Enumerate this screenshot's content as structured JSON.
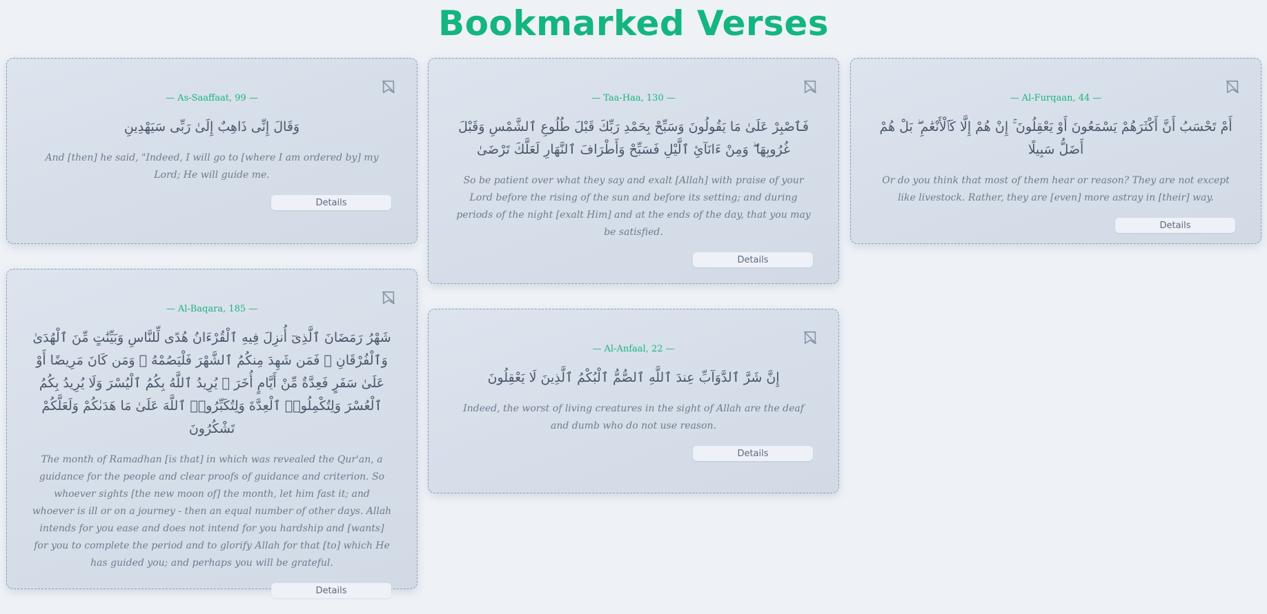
{
  "page": {
    "title": "Bookmarked Verses"
  },
  "colors": {
    "accent": "#14b57e",
    "card_bg": "#d8e0ea",
    "page_bg": "#eef2f7"
  },
  "cards": [
    {
      "ref": "— As-Saaffaat, 99 —",
      "arabic": "وَقَالَ إِنِّى ذَاهِبٌ إِلَىٰ رَبِّى سَيَهْدِينِ",
      "translation": "And [then] he said, \"Indeed, I will go to [where I am ordered by] my Lord; He will guide me.",
      "details_label": "Details",
      "bookmark_icon": "bookmark-off-icon"
    },
    {
      "ref": "— Al-Baqara, 185 —",
      "arabic": "شَهْرُ رَمَضَانَ ٱلَّذِىٓ أُنزِلَ فِيهِ ٱلْقُرْءَانُ هُدًى لِّلنَّاسِ وَبَيِّنَٰتٍ مِّنَ ٱلْهُدَىٰ وَٱلْفُرْقَانِ ۚ فَمَن شَهِدَ مِنكُمُ ٱلشَّهْرَ فَلْيَصُمْهُ ۖ وَمَن كَانَ مَرِيضًا أَوْ عَلَىٰ سَفَرٍ فَعِدَّةٌ مِّنْ أَيَّامٍ أُخَرَ ۗ يُرِيدُ ٱللَّهُ بِكُمُ ٱلْيُسْرَ وَلَا يُرِيدُ بِكُمُ ٱلْعُسْرَ وَلِتُكْمِلُوا۟ ٱلْعِدَّةَ وَلِتُكَبِّرُوا۟ ٱللَّهَ عَلَىٰ مَا هَدَىٰكُمْ وَلَعَلَّكُمْ تَشْكُرُونَ",
      "translation": "The month of Ramadhan [is that] in which was revealed the Qur'an, a guidance for the people and clear proofs of guidance and criterion. So whoever sights [the new moon of] the month, let him fast it; and whoever is ill or on a journey - then an equal number of other days. Allah intends for you ease and does not intend for you hardship and [wants] for you to complete the period and to glorify Allah for that [to] which He has guided you; and perhaps you will be grateful.",
      "details_label": "Details",
      "bookmark_icon": "bookmark-off-icon"
    },
    {
      "ref": "— Taa-Haa, 130 —",
      "arabic": "فَٱصْبِرْ عَلَىٰ مَا يَقُولُونَ وَسَبِّحْ بِحَمْدِ رَبِّكَ قَبْلَ طُلُوعِ ٱلشَّمْسِ وَقَبْلَ غُرُوبِهَا ۖ وَمِنْ ءَانَآئِ ٱلَّيْلِ فَسَبِّحْ وَأَطْرَافَ ٱلنَّهَارِ لَعَلَّكَ تَرْضَىٰ",
      "translation": "So be patient over what they say and exalt [Allah] with praise of your Lord before the rising of the sun and before its setting; and during periods of the night [exalt Him] and at the ends of the day, that you may be satisfied.",
      "details_label": "Details",
      "bookmark_icon": "bookmark-off-icon"
    },
    {
      "ref": "— Al-Anfaal, 22 —",
      "arabic": "إِنَّ شَرَّ ٱلدَّوَآبِّ عِندَ ٱللَّهِ ٱلصُّمُّ ٱلْبُكْمُ ٱلَّذِينَ لَا يَعْقِلُونَ",
      "translation": "Indeed, the worst of living creatures in the sight of Allah are the deaf and dumb who do not use reason.",
      "details_label": "Details",
      "bookmark_icon": "bookmark-off-icon"
    },
    {
      "ref": "— Al-Furqaan, 44 —",
      "arabic": "أَمْ تَحْسَبُ أَنَّ أَكْثَرَهُمْ يَسْمَعُونَ أَوْ يَعْقِلُونَ ۚ إِنْ هُمْ إِلَّا كَٱلْأَنْعَٰمِ ۖ بَلْ هُمْ أَضَلُّ سَبِيلًا",
      "translation": "Or do you think that most of them hear or reason? They are not except like livestock. Rather, they are [even] more astray in [their] way.",
      "details_label": "Details",
      "bookmark_icon": "bookmark-off-icon"
    }
  ]
}
